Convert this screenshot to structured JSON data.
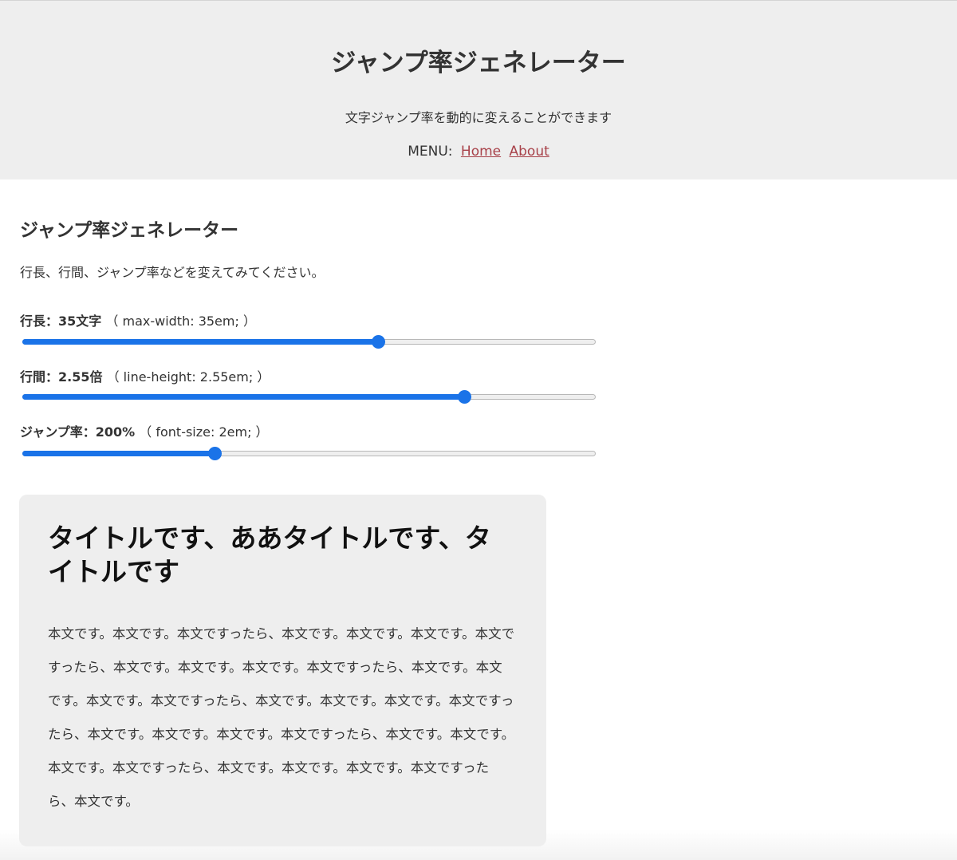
{
  "header": {
    "title": "ジャンプ率ジェネレーター",
    "description": "文字ジャンプ率を動的に変えることができます",
    "menu_label": "MENU:",
    "menu_items": [
      "Home",
      "About"
    ]
  },
  "main": {
    "title": "ジャンプ率ジェネレーター",
    "intro": "行長、行間、ジャンプ率などを変えてみてください。"
  },
  "controls": [
    {
      "label": "行長：",
      "value": "35文字",
      "css": "（ max-width: 35em; ）",
      "level": 0.62
    },
    {
      "label": "行間：",
      "value": "2.55倍",
      "css": "（ line-height: 2.55em; ）",
      "level": 0.77
    },
    {
      "label": "ジャンプ率：",
      "value": "200%",
      "css": "（ font-size: 2em; ）",
      "level": 0.335
    }
  ],
  "preview": {
    "title": "タイトルです、ああタイトルです、タイトルです",
    "body": "本文です。本文です。本文ですったら、本文です。本文です。本文です。本文ですったら、本文です。本文です。本文です。本文ですったら、本文です。本文です。本文です。本文ですったら、本文です。本文です。本文です。本文ですったら、本文です。本文です。本文です。本文ですったら、本文です。本文です。本文です。本文ですったら、本文です。本文です。本文です。本文ですったら、本文です。"
  },
  "colors": {
    "accent": "#1a73e8",
    "link": "#a8424a",
    "header_bg": "#eeeeee",
    "preview_bg": "#eeeeee"
  }
}
